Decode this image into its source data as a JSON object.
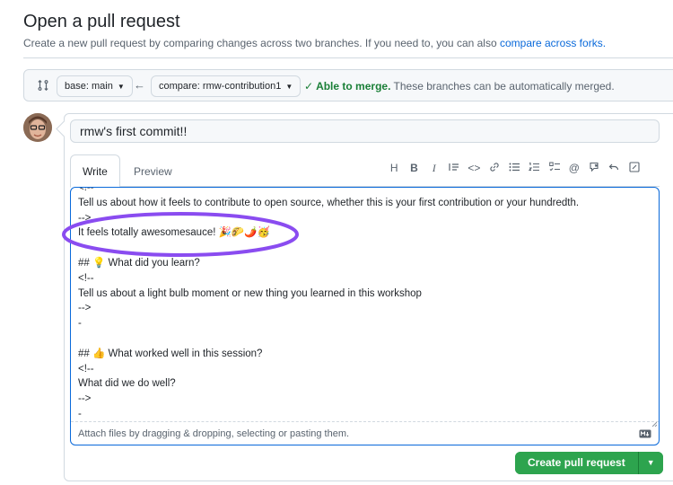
{
  "page": {
    "title": "Open a pull request",
    "subtitle_text": "Create a new pull request by comparing changes across two branches. If you need to, you can also ",
    "subtitle_link": "compare across forks."
  },
  "range": {
    "base_label": "base: main",
    "compare_label": "compare: rmw-contribution1",
    "merge_status_strong": "Able to merge.",
    "merge_status_text": " These branches can be automatically merged."
  },
  "form": {
    "title_value": "rmw's first commit!!",
    "tabs": {
      "write": "Write",
      "preview": "Preview"
    },
    "toolbar_icons": [
      "heading-icon",
      "bold-icon",
      "italic-icon",
      "quote-icon",
      "code-icon",
      "link-icon",
      "unordered-list-icon",
      "ordered-list-icon",
      "task-list-icon",
      "mention-icon",
      "reference-icon",
      "undo-icon",
      "fullscreen-icon"
    ],
    "body_lines": [
      "<!--",
      "Tell us about how it feels to contribute to open source, whether this is your first contribution or your hundredth.",
      "-->",
      "It feels totally awesomesauce! 🎉🌮🌶️🥳",
      "",
      "## 💡 What did you learn?",
      "<!--",
      "Tell us about a light bulb moment or new thing you learned in this workshop",
      "-->",
      "-",
      "",
      "## 👍 What worked well in this session?",
      "<!--",
      "What did we do well?",
      "-->",
      "-"
    ],
    "attach_text": "Attach files by dragging & dropping, selecting or pasting them."
  },
  "actions": {
    "submit_label": "Create pull request"
  },
  "colors": {
    "link": "#0969da",
    "success": "#1a7f37",
    "primary_button": "#2da44e",
    "highlight_ellipse": "#8a4cf0",
    "editor_focus_border": "#0969da"
  }
}
